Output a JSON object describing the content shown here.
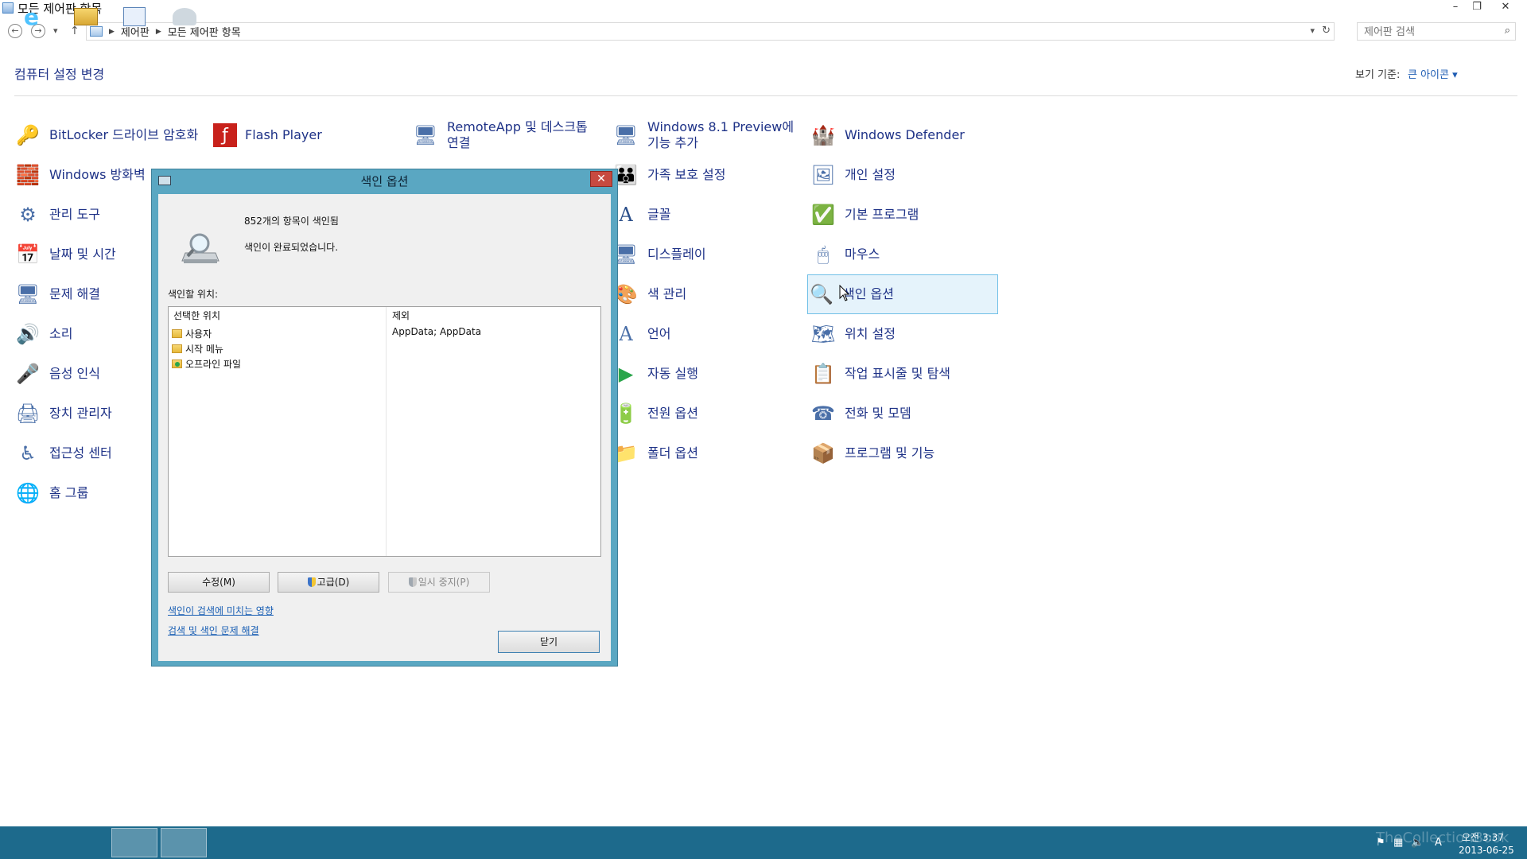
{
  "window": {
    "title": "모든 제어판 항목",
    "minimize": "–",
    "restore": "❐",
    "close": "✕"
  },
  "address": {
    "crumbs": [
      "제어판",
      "모든 제어판 항목"
    ],
    "search_placeholder": "제어판 검색"
  },
  "header": {
    "title": "컴퓨터 설정 변경",
    "view_by_label": "보기 기준:",
    "view_by_value": "큰 아이콘 ▾"
  },
  "items": {
    "bitlocker": "BitLocker 드라이브 암호화",
    "flash": "Flash Player",
    "remoteapp": "RemoteApp 및 데스크톱 연결",
    "win81": "Windows 8.1 Preview에 기능 추가",
    "defender": "Windows Defender",
    "firewall": "Windows 방화벽",
    "family": "가족 보호 설정",
    "personal": "개인 설정",
    "admintools": "관리 도구",
    "fonts": "글꼴",
    "defaultprog": "기본 프로그램",
    "datetime": "날짜 및 시간",
    "display": "디스플레이",
    "mouse": "마우스",
    "troubleshoot": "문제 해결",
    "color": "색 관리",
    "indexing": "색인 옵션",
    "sound": "소리",
    "language": "언어",
    "location": "위치 설정",
    "speech": "음성 인식",
    "autoplay": "자동 실행",
    "taskbar": "작업 표시줄 및 탐색",
    "devmgr": "장치 관리자",
    "power": "전원 옵션",
    "phone": "전화 및 모뎀",
    "ease": "접근성 센터",
    "folder": "폴더 옵션",
    "programs": "프로그램 및 기능",
    "homegroup": "홈 그룹"
  },
  "dialog": {
    "title": "색인 옵션",
    "indexed_count": "852개의 항목이 색인됨",
    "status": "색인이 완료되었습니다.",
    "locations_label": "색인할 위치:",
    "col_selected": "선택한 위치",
    "col_exclude": "제외",
    "rows": [
      {
        "name": "사용자",
        "exclude": "AppData; AppData"
      },
      {
        "name": "시작 메뉴",
        "exclude": ""
      },
      {
        "name": "오프라인 파일",
        "exclude": ""
      }
    ],
    "modify_btn": "수정(M)",
    "advanced_btn": "고급(D)",
    "pause_btn": "일시 중지(P)",
    "link_effects": "색인이 검색에 미치는 영향",
    "link_troubleshoot": "검색 및 색인 문제 해결",
    "close_btn": "닫기"
  },
  "taskbar": {
    "watermark": "TheCollectionBook",
    "time": "오전 3:37",
    "date": "2013-06-25",
    "ime": "A"
  }
}
